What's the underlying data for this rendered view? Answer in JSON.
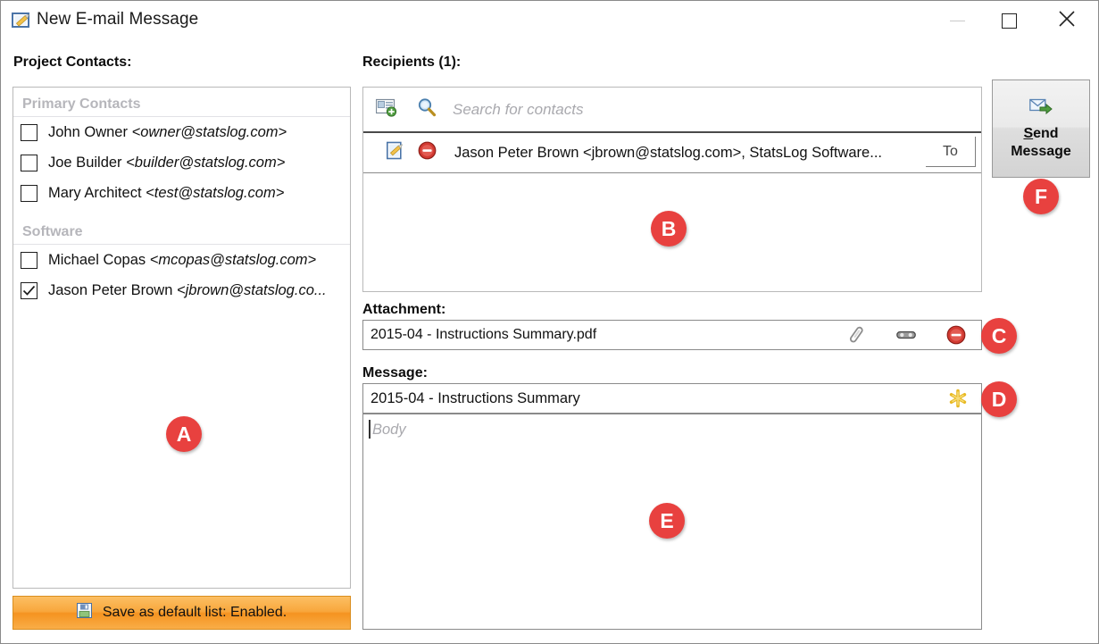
{
  "window": {
    "title": "New E-mail Message",
    "title_icon": "note-pencil-icon",
    "controls": {
      "minimize": "minimize-icon",
      "maximize": "maximize-icon",
      "close": "close-icon"
    }
  },
  "colors": {
    "badge_red": "#e8413f",
    "save_bar_orange": "#f59320",
    "group_header_gray": "#b6b6bb",
    "placeholder_gray": "#a9a9ae"
  },
  "contacts": {
    "label": "Project Contacts:",
    "groups": [
      {
        "name": "Primary Contacts",
        "items": [
          {
            "checked": false,
            "name": "John Owner",
            "email": "<owner@statslog.com>"
          },
          {
            "checked": false,
            "name": "Joe Builder",
            "email": "<builder@statslog.com>"
          },
          {
            "checked": false,
            "name": "Mary Architect",
            "email": "<test@statslog.com>"
          }
        ]
      },
      {
        "name": "Software",
        "items": [
          {
            "checked": false,
            "name": "Michael Copas",
            "email": "<mcopas@statslog.com>"
          },
          {
            "checked": true,
            "name": "Jason Peter Brown",
            "email": "<jbrown@statslog.co..."
          }
        ]
      }
    ],
    "save_default": {
      "label": "Save as default list: Enabled.",
      "icon": "floppy-save-icon"
    }
  },
  "recipients": {
    "label": "Recipients (1):",
    "count": 1,
    "search": {
      "placeholder": "Search for contacts",
      "add_icon": "add-contact-card-icon",
      "search_icon": "magnifier-icon"
    },
    "rows": [
      {
        "edit_icon": "edit-pencil-icon",
        "remove_icon": "remove-circle-icon",
        "text": "Jason Peter Brown <jbrown@statslog.com>, StatsLog Software...",
        "to_label": "To"
      }
    ]
  },
  "attachment": {
    "label": "Attachment:",
    "value": "2015-04 - Instructions Summary.pdf",
    "icons": {
      "attach": "paperclip-icon",
      "preview": "glasses-preview-icon",
      "remove": "remove-circle-icon"
    }
  },
  "message": {
    "label": "Message:",
    "subject": "2015-04 - Instructions Summary",
    "subject_icon": "gold-asterisk-icon",
    "body_placeholder": "Body"
  },
  "send": {
    "icon": "send-envelope-icon",
    "line1": "Send",
    "line1_mnemonic": "S",
    "line1_rest": "end",
    "line2": "Message"
  },
  "badges": {
    "a": "A",
    "b": "B",
    "c": "C",
    "d": "D",
    "e": "E",
    "f": "F"
  }
}
